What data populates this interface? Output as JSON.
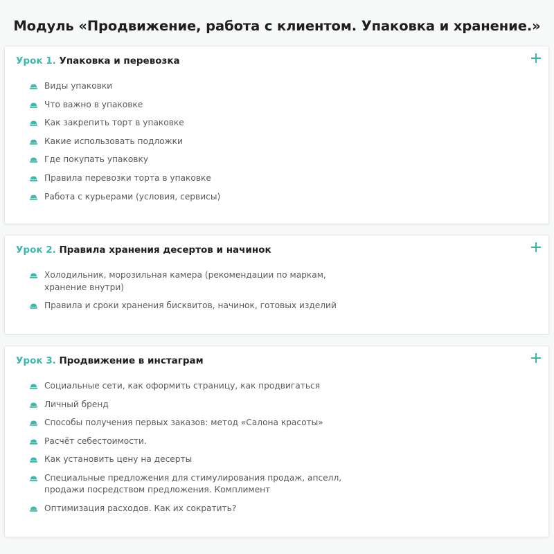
{
  "module_title": "Модуль «Продвижение, работа с клиентом. Упаковка и хранение.»",
  "colors": {
    "accent": "#3cb8ab",
    "text": "#1e1e1e",
    "muted": "#555b5b",
    "background": "#f7f8f8"
  },
  "lessons": [
    {
      "number": "Урок 1.",
      "title": "Упаковка и перевозка",
      "icon": "plus-icon",
      "topics": [
        "Виды упаковки",
        "Что важно в упаковке",
        "Как закрепить торт в упаковке",
        "Какие использовать подложки",
        "Где покупать упаковку",
        "Правила перевозки торта в упаковке",
        "Работа с курьерами (условия, сервисы)"
      ]
    },
    {
      "number": "Урок 2.",
      "title": "Правила хранения десертов и начинок",
      "icon": "plus-icon",
      "topics": [
        "Холодильник, морозильная камера (рекомендации по маркам, хранение внутри)",
        "Правила и сроки хранения бисквитов, начинок, готовых изделий"
      ]
    },
    {
      "number": "Урок 3.",
      "title": "Продвижение в инстаграм",
      "icon": "plus-icon",
      "topics": [
        "Социальные сети, как оформить страницу, как продвигаться",
        "Личный бренд",
        "Способы получения первых заказов: метод «Салона красоты»",
        "Расчёт себестоимости.",
        "Как установить цену на десерты",
        "Специальные предложения для стимулирования продаж, апселл, продажи посредством предложения. Комплимент",
        "Оптимизация расходов. Как их сократить?"
      ]
    }
  ]
}
